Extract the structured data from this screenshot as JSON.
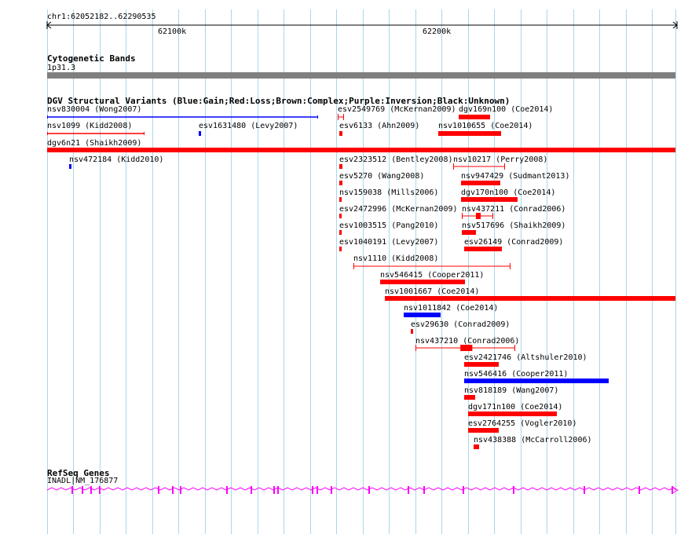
{
  "ruler": {
    "location": "chr1:62052182..62290535",
    "ticks": [
      "62100k",
      "62200k"
    ]
  },
  "cytogenetic": {
    "title": "Cytogenetic Bands",
    "band": "1p31.3"
  },
  "dgv": {
    "title": "DGV Structural Variants (Blue:Gain;Red:Loss;Brown:Complex;Purple:Inversion;Black:Unknown)",
    "colors": {
      "gain": "#0000ff",
      "loss": "#ff0000",
      "complex": "#8b4513",
      "inversion": "#800080",
      "unknown": "#000000"
    },
    "features": [
      {
        "label": "nsv830004 (Wong2007)",
        "type": "gain"
      },
      {
        "label": "esv2549769 (McKernan2009)",
        "type": "loss"
      },
      {
        "label": "dgv169n100 (Coe2014)",
        "type": "loss"
      },
      {
        "label": "nsv1099 (Kidd2008)",
        "type": "loss"
      },
      {
        "label": "esv1631480 (Levy2007)",
        "type": "gain"
      },
      {
        "label": "esv6133 (Ahn2009)",
        "type": "loss"
      },
      {
        "label": "nsv1010655 (Coe2014)",
        "type": "loss"
      },
      {
        "label": "dgv6n21 (Shaikh2009)",
        "type": "loss"
      },
      {
        "label": "nsv472184 (Kidd2010)",
        "type": "gain"
      },
      {
        "label": "esv2323512 (Bentley2008)",
        "type": "loss"
      },
      {
        "label": "nsv10217 (Perry2008)",
        "type": "loss"
      },
      {
        "label": "esv5270 (Wang2008)",
        "type": "loss"
      },
      {
        "label": "nsv947429 (Sudmant2013)",
        "type": "loss"
      },
      {
        "label": "nsv159038 (Mills2006)",
        "type": "loss"
      },
      {
        "label": "dgv170n100 (Coe2014)",
        "type": "loss"
      },
      {
        "label": "esv2472996 (McKernan2009)",
        "type": "loss"
      },
      {
        "label": "nsv437211 (Conrad2006)",
        "type": "loss"
      },
      {
        "label": "esv1003515 (Pang2010)",
        "type": "loss"
      },
      {
        "label": "nsv517696 (Shaikh2009)",
        "type": "loss"
      },
      {
        "label": "esv1040191 (Levy2007)",
        "type": "loss"
      },
      {
        "label": "esv26149 (Conrad2009)",
        "type": "loss"
      },
      {
        "label": "nsv1110 (Kidd2008)",
        "type": "loss"
      },
      {
        "label": "nsv546415 (Cooper2011)",
        "type": "loss"
      },
      {
        "label": "nsv1001667 (Coe2014)",
        "type": "loss"
      },
      {
        "label": "nsv1011842 (Coe2014)",
        "type": "gain"
      },
      {
        "label": "esv29630 (Conrad2009)",
        "type": "loss"
      },
      {
        "label": "nsv437210 (Conrad2006)",
        "type": "loss"
      },
      {
        "label": "esv2421746 (Altshuler2010)",
        "type": "loss"
      },
      {
        "label": "nsv546416 (Cooper2011)",
        "type": "gain"
      },
      {
        "label": "nsv818189 (Wang2007)",
        "type": "loss"
      },
      {
        "label": "dgv171n100 (Coe2014)",
        "type": "loss"
      },
      {
        "label": "esv2764255 (Vogler2010)",
        "type": "loss"
      },
      {
        "label": "nsv438388 (McCarroll2006)",
        "type": "loss"
      }
    ]
  },
  "refseq": {
    "title": "RefSeq Genes",
    "gene": "INADL|NM_176877",
    "color": "#ff00ff"
  }
}
